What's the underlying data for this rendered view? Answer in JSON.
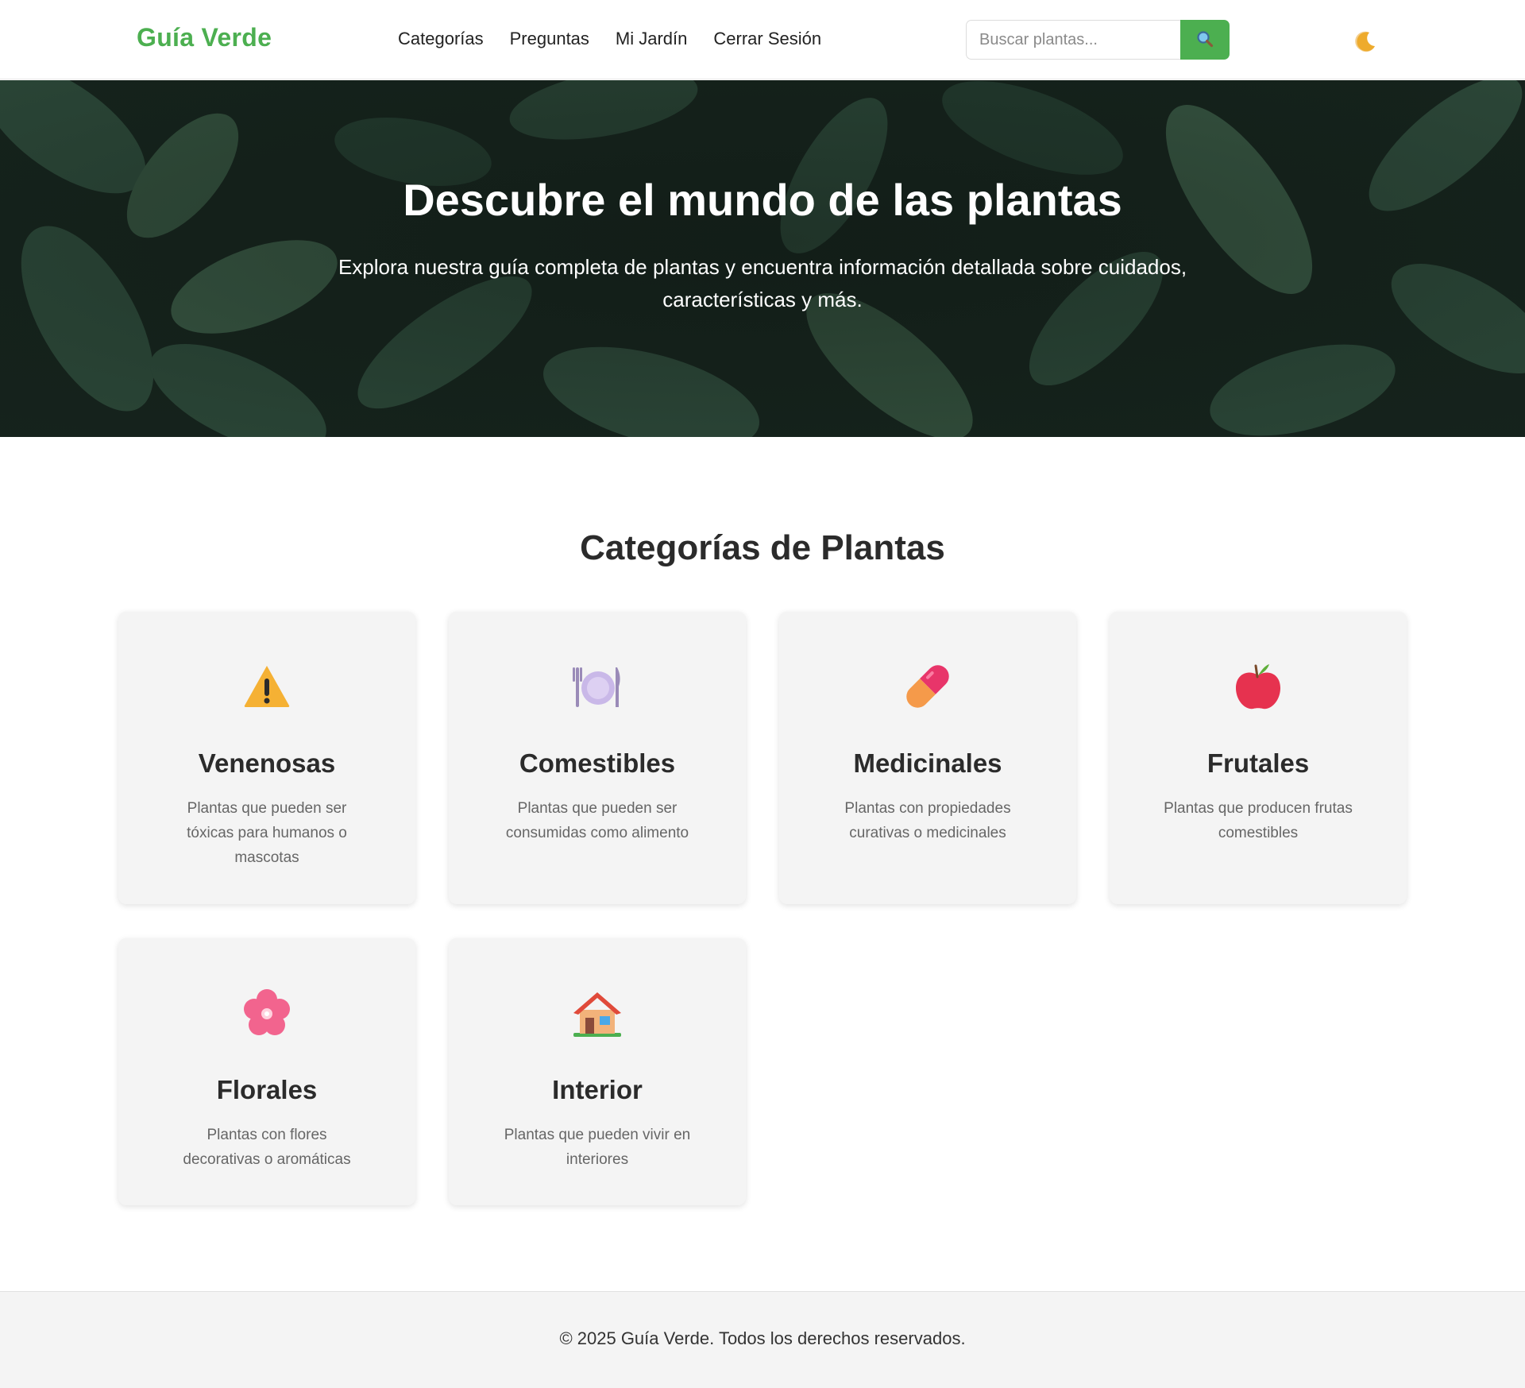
{
  "header": {
    "logo": "Guía Verde",
    "nav": [
      "Categorías",
      "Preguntas",
      "Mi Jardín",
      "Cerrar Sesión"
    ],
    "search_placeholder": "Buscar plantas...",
    "search_icon": "magnifier-icon",
    "theme_icon": "moon-icon"
  },
  "hero": {
    "title": "Descubre el mundo de las plantas",
    "subtitle": "Explora nuestra guía completa de plantas y encuentra información detallada sobre cuidados, características y más."
  },
  "categories": {
    "title": "Categorías de Plantas",
    "items": [
      {
        "name": "Venenosas",
        "description": "Plantas que pueden ser tóxicas para humanos o mascotas",
        "icon": "warning-icon"
      },
      {
        "name": "Comestibles",
        "description": "Plantas que pueden ser consumidas como alimento",
        "icon": "plate-cutlery-icon"
      },
      {
        "name": "Medicinales",
        "description": "Plantas con propiedades curativas o medicinales",
        "icon": "pill-icon"
      },
      {
        "name": "Frutales",
        "description": "Plantas que producen frutas comestibles",
        "icon": "apple-icon"
      },
      {
        "name": "Florales",
        "description": "Plantas con flores decorativas o aromáticas",
        "icon": "flower-icon"
      },
      {
        "name": "Interior",
        "description": "Plantas que pueden vivir en interiores",
        "icon": "house-icon"
      }
    ]
  },
  "footer": {
    "text": "© 2025 Guía Verde. Todos los derechos reservados."
  },
  "colors": {
    "brand": "#4caf50",
    "card_bg": "#f4f4f4",
    "footer_bg": "#f4f4f4",
    "hero_bg": "#13201a"
  }
}
